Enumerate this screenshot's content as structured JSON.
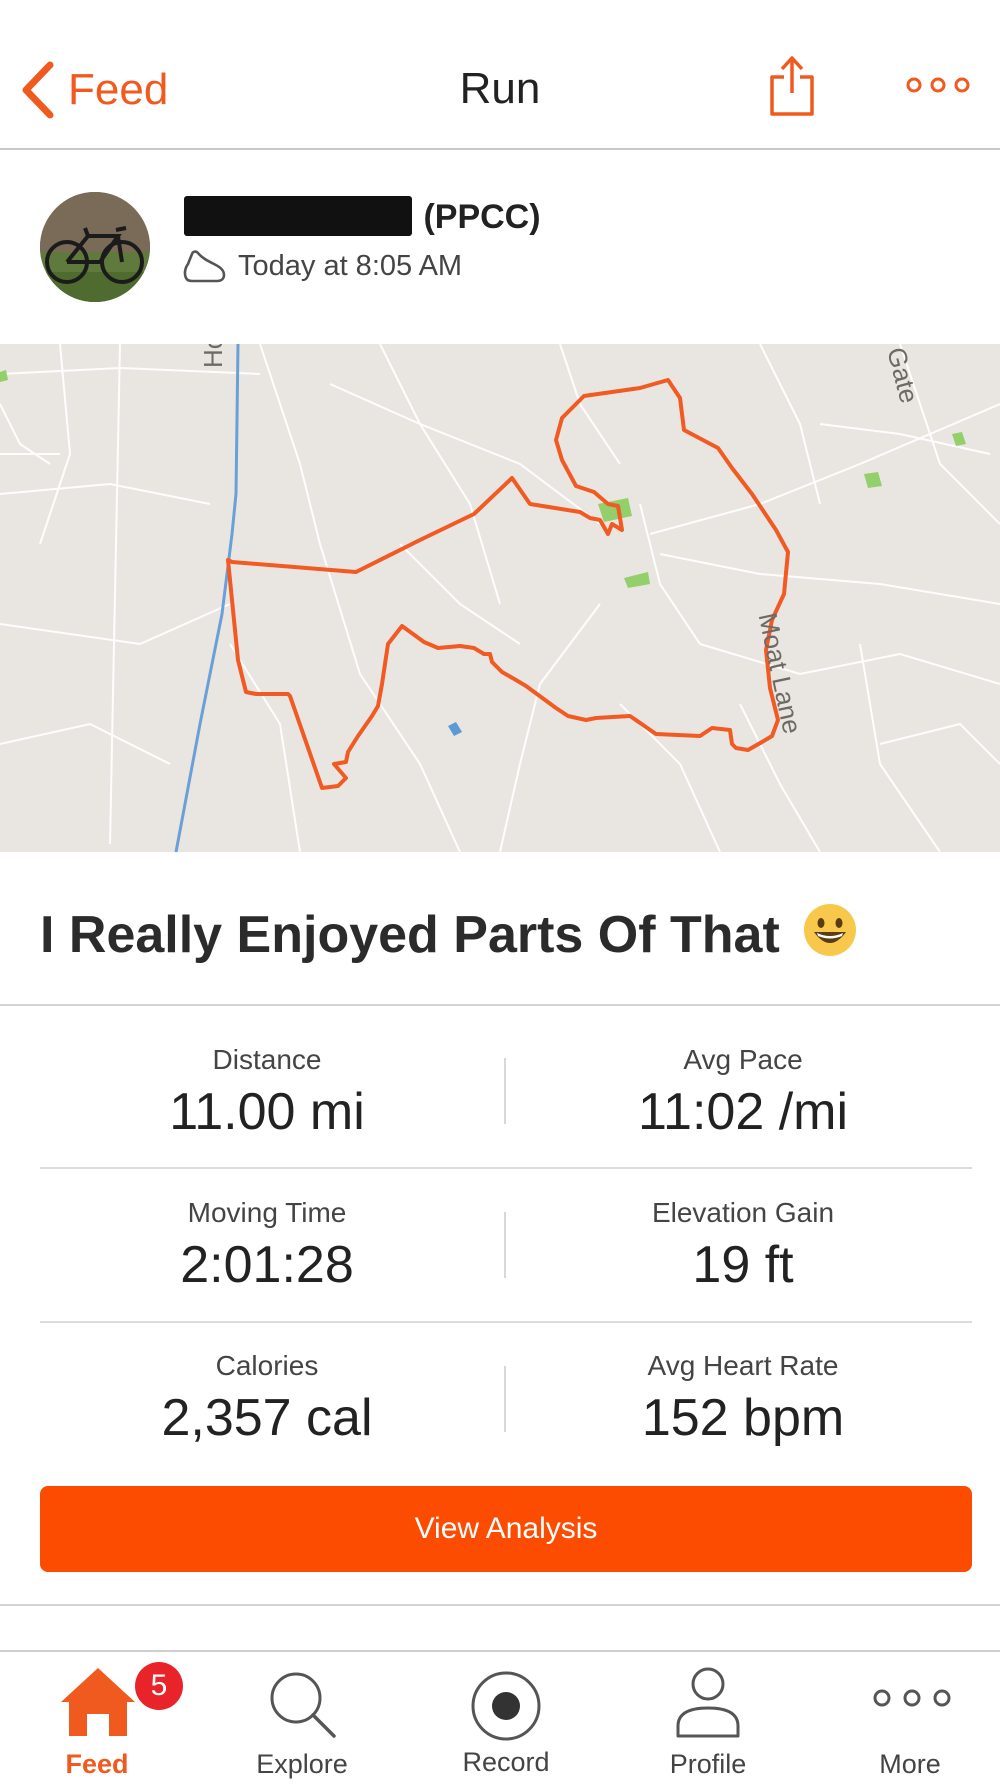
{
  "header": {
    "back_label": "Feed",
    "title": "Run",
    "share_icon": "share-icon",
    "more_icon": "more-horizontal-icon",
    "accent_color": "#F05A1E"
  },
  "athlete": {
    "name_suffix": "(PPCC)",
    "activity_icon": "shoe-icon",
    "timestamp": "Today at 8:05 AM"
  },
  "map": {
    "road_labels": [
      "Hob",
      "Moat Lane",
      "Gate"
    ],
    "route_color": "#F15A22"
  },
  "activity": {
    "title": "I Really Enjoyed Parts Of That",
    "emoji": "grinning-face-emoji"
  },
  "stats": [
    {
      "label": "Distance",
      "value": "11.00 mi"
    },
    {
      "label": "Avg Pace",
      "value": "11:02 /mi"
    },
    {
      "label": "Moving Time",
      "value": "2:01:28"
    },
    {
      "label": "Elevation Gain",
      "value": "19 ft"
    },
    {
      "label": "Calories",
      "value": "2,357 cal"
    },
    {
      "label": "Avg Heart Rate",
      "value": "152 bpm"
    }
  ],
  "analysis_button": "View Analysis",
  "tabbar": {
    "tabs": [
      {
        "label": "Feed",
        "icon": "home-icon",
        "active": true,
        "badge": "5"
      },
      {
        "label": "Explore",
        "icon": "search-icon"
      },
      {
        "label": "Record",
        "icon": "record-icon"
      },
      {
        "label": "Profile",
        "icon": "profile-icon"
      },
      {
        "label": "More",
        "icon": "more-horizontal-icon"
      }
    ],
    "badge_color": "#E8232A"
  }
}
